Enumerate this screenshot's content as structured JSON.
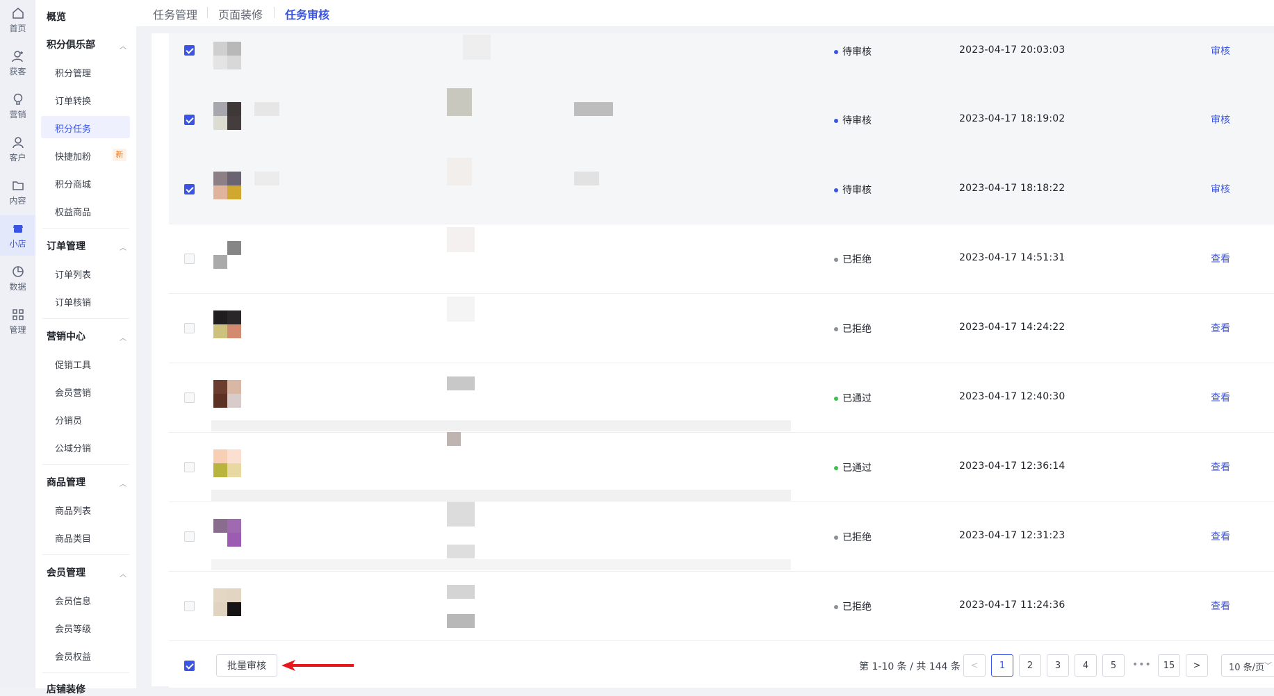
{
  "rail": {
    "items": [
      {
        "label": "首页",
        "icon": "home-icon"
      },
      {
        "label": "获客",
        "icon": "user-add-icon"
      },
      {
        "label": "营销",
        "icon": "bulb-icon"
      },
      {
        "label": "客户",
        "icon": "user-icon"
      },
      {
        "label": "内容",
        "icon": "folder-icon"
      },
      {
        "label": "小店",
        "icon": "shop-icon"
      },
      {
        "label": "数据",
        "icon": "pie-chart-icon"
      },
      {
        "label": "管理",
        "icon": "grid-icon"
      }
    ],
    "active_label": "小店"
  },
  "subnav": {
    "overview": "概览",
    "groups": [
      {
        "title": "积分俱乐部",
        "items": [
          "积分管理",
          "订单转换",
          "积分任务",
          "快捷加粉",
          "积分商城",
          "权益商品"
        ]
      },
      {
        "title": "订单管理",
        "items": [
          "订单列表",
          "订单核销"
        ]
      },
      {
        "title": "营销中心",
        "items": [
          "促销工具",
          "会员营销",
          "分销员",
          "公域分销"
        ]
      },
      {
        "title": "商品管理",
        "items": [
          "商品列表",
          "商品类目"
        ]
      },
      {
        "title": "会员管理",
        "items": [
          "会员信息",
          "会员等级",
          "会员权益"
        ]
      },
      {
        "title": "店铺装修",
        "items": []
      }
    ],
    "active_item": "积分任务",
    "new_badge": "新"
  },
  "breadcrumb": {
    "items": [
      "任务管理",
      "页面装修",
      "任务审核"
    ]
  },
  "table": {
    "rows": [
      {
        "checked": true,
        "status": "待审核",
        "status_color": "#3a55e6",
        "time": "2023-04-17 20:03:03",
        "action": "审核",
        "thumb": [
          "#cfcfcf",
          "#b8b8b8",
          "#e4e4e4",
          "#d8d8d8"
        ]
      },
      {
        "checked": true,
        "status": "待审核",
        "status_color": "#3a55e6",
        "time": "2023-04-17 18:19:02",
        "action": "审核",
        "thumb": [
          "#a8a7ad",
          "#3e3838",
          "#dcdcd2",
          "#453d3d"
        ]
      },
      {
        "checked": true,
        "status": "待审核",
        "status_color": "#3a55e6",
        "time": "2023-04-17 18:18:22",
        "action": "审核",
        "thumb": [
          "#8c7f86",
          "#6a6472",
          "#e0b49c",
          "#d0a830"
        ]
      },
      {
        "checked": false,
        "status": "已拒绝",
        "status_color": "#8a8f99",
        "time": "2023-04-17 14:51:31",
        "action": "查看",
        "thumb": [
          "#ffffff",
          "#868686",
          "#aaaaaa",
          "#ffffff"
        ]
      },
      {
        "checked": false,
        "status": "已拒绝",
        "status_color": "#8a8f99",
        "time": "2023-04-17 14:24:22",
        "action": "查看",
        "thumb": [
          "#1f1d1e",
          "#2a2728",
          "#ccc27e",
          "#d28a70"
        ]
      },
      {
        "checked": false,
        "status": "已通过",
        "status_color": "#3cc24a",
        "time": "2023-04-17 12:40:30",
        "action": "查看",
        "thumb": [
          "#6b3d2e",
          "#d9b7a5",
          "#5c3022",
          "#d8cccb"
        ]
      },
      {
        "checked": false,
        "status": "已通过",
        "status_color": "#3cc24a",
        "time": "2023-04-17 12:36:14",
        "action": "查看",
        "thumb": [
          "#f6cfb4",
          "#fbe0d2",
          "#b8b43e",
          "#e8d8a2"
        ]
      },
      {
        "checked": false,
        "status": "已拒绝",
        "status_color": "#8a8f99",
        "time": "2023-04-17 12:31:23",
        "action": "查看",
        "thumb": [
          "#8a6d8e",
          "#a06ab0",
          "#ffffff",
          "#9c5cb2"
        ]
      },
      {
        "checked": false,
        "status": "已拒绝",
        "status_color": "#8a8f99",
        "time": "2023-04-17 11:24:36",
        "action": "查看",
        "thumb": [
          "#e4d8c4",
          "#e2d6c2",
          "#e0d4c0",
          "#161414"
        ]
      }
    ]
  },
  "footer": {
    "batch_button": "批量审核",
    "summary": "第 1-10 条 / 共 144 条",
    "pages": [
      "1",
      "2",
      "3",
      "4",
      "5"
    ],
    "ellipsis": "•••",
    "last_page": "15",
    "prev": "<",
    "next": ">",
    "page_size": "10 条/页",
    "current_page": "1",
    "select_all_checked": true
  }
}
